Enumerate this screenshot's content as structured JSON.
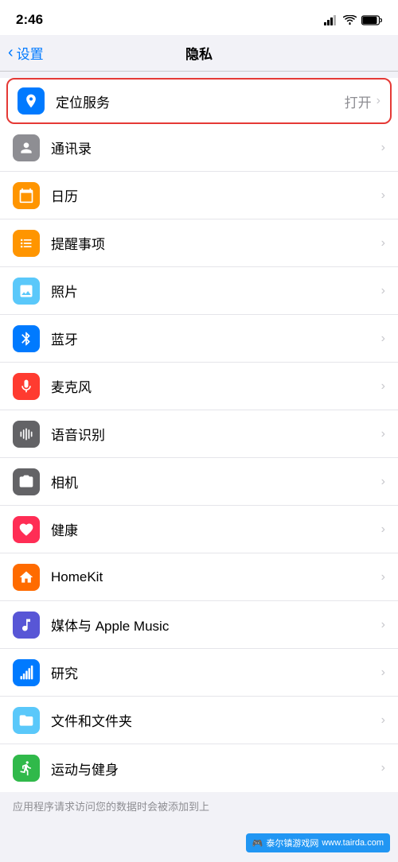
{
  "statusBar": {
    "time": "2:46",
    "signal": "signal",
    "wifi": "wifi",
    "battery": "battery"
  },
  "navBar": {
    "backLabel": "设置",
    "title": "隐私"
  },
  "items": [
    {
      "id": "location",
      "label": "定位服务",
      "value": "打开",
      "iconBg": "icon-blue",
      "icon": "location",
      "highlighted": true
    },
    {
      "id": "contacts",
      "label": "通讯录",
      "value": "",
      "iconBg": "icon-gray",
      "icon": "contacts",
      "highlighted": false
    },
    {
      "id": "calendar",
      "label": "日历",
      "value": "",
      "iconBg": "icon-orange-light",
      "icon": "calendar",
      "highlighted": false
    },
    {
      "id": "reminders",
      "label": "提醒事项",
      "value": "",
      "iconBg": "icon-orange-light",
      "icon": "reminders",
      "highlighted": false
    },
    {
      "id": "photos",
      "label": "照片",
      "value": "",
      "iconBg": "icon-teal",
      "icon": "photos",
      "highlighted": false
    },
    {
      "id": "bluetooth",
      "label": "蓝牙",
      "value": "",
      "iconBg": "icon-blue",
      "icon": "bluetooth",
      "highlighted": false
    },
    {
      "id": "microphone",
      "label": "麦克风",
      "value": "",
      "iconBg": "icon-red",
      "icon": "microphone",
      "highlighted": false
    },
    {
      "id": "speechrecognition",
      "label": "语音识别",
      "value": "",
      "iconBg": "icon-dark-gray",
      "icon": "speechrecognition",
      "highlighted": false
    },
    {
      "id": "camera",
      "label": "相机",
      "value": "",
      "iconBg": "icon-dark-gray",
      "icon": "camera",
      "highlighted": false
    },
    {
      "id": "health",
      "label": "健康",
      "value": "",
      "iconBg": "icon-pink",
      "icon": "health",
      "highlighted": false
    },
    {
      "id": "homekit",
      "label": "HomeKit",
      "value": "",
      "iconBg": "icon-orange",
      "icon": "homekit",
      "highlighted": false
    },
    {
      "id": "media",
      "label": "媒体与 Apple Music",
      "value": "",
      "iconBg": "icon-indigo",
      "icon": "music",
      "highlighted": false
    },
    {
      "id": "research",
      "label": "研究",
      "value": "",
      "iconBg": "icon-blue2",
      "icon": "research",
      "highlighted": false
    },
    {
      "id": "files",
      "label": "文件和文件夹",
      "value": "",
      "iconBg": "icon-blue-light",
      "icon": "files",
      "highlighted": false
    },
    {
      "id": "fitness",
      "label": "运动与健身",
      "value": "",
      "iconBg": "icon-green2",
      "icon": "fitness",
      "highlighted": false
    }
  ],
  "bottomNote": "应用程序请求访问您的数据时会被添加到上",
  "watermark": {
    "label": "泰尔镇游戏网",
    "url": "www.tairda.com"
  }
}
